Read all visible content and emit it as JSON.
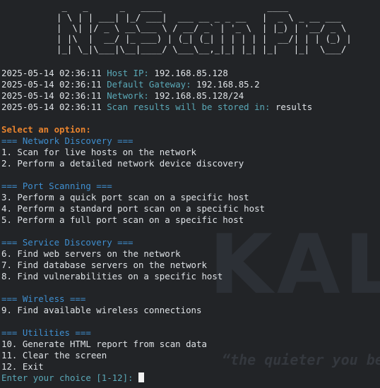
{
  "banner_art": " _   _      _   ____                    ____\n| \\ | | ___| |_/ ___|  ___ __ _ _ __   |  _ \\ _ __ ___\n|  \\| |/ _ \\ __\\___ \\ / __/ _` | '_ \\  | |_) | '__/ _ \\\n| |\\  |  __/ |_ ___) | (_| (_| | | | | |  __/| | | (_) |\n|_| \\_|\\___|\\__|____/ \\___\\__,_|_| |_| |_|   |_|  \\___/",
  "info_lines": [
    {
      "timestamp": "2025-05-14 02:36:11",
      "key": "Host IP:",
      "value": "192.168.85.128"
    },
    {
      "timestamp": "2025-05-14 02:36:11",
      "key": "Default Gateway:",
      "value": "192.168.85.2"
    },
    {
      "timestamp": "2025-05-14 02:36:11",
      "key": "Network:",
      "value": "192.168.85.128/24"
    },
    {
      "timestamp": "2025-05-14 02:36:11",
      "key": "Scan results will be stored in:",
      "value": "results"
    }
  ],
  "menu_prompt": "Select an option:",
  "sections": [
    {
      "title": "=== Network Discovery ===",
      "options": [
        "1. Scan for live hosts on the network",
        "2. Perform a detailed network device discovery"
      ]
    },
    {
      "title": "=== Port Scanning ===",
      "options": [
        "3. Perform a quick port scan on a specific host",
        "4. Perform a standard port scan on a specific host",
        "5. Perform a full port scan on a specific host"
      ]
    },
    {
      "title": "=== Service Discovery ===",
      "options": [
        "6. Find web servers on the network",
        "7. Find database servers on the network",
        "8. Find vulnerabilities on a specific host"
      ]
    },
    {
      "title": "=== Wireless ===",
      "options": [
        "9. Find available wireless connections"
      ]
    },
    {
      "title": "=== Utilities ===",
      "options": [
        "10. Generate HTML report from scan data",
        "11. Clear the screen",
        "12. Exit"
      ]
    }
  ],
  "input_prompt": "Enter your choice [1-12]: ",
  "watermark": {
    "word": "KALI",
    "quote": "“the quieter you become, the more you are able to hear”"
  },
  "colors": {
    "background": "#222427",
    "text": "#dfe3e7",
    "info_key": "#5aa9b8",
    "section_title": "#3f8fd0",
    "prompt_title": "#e8832e"
  }
}
